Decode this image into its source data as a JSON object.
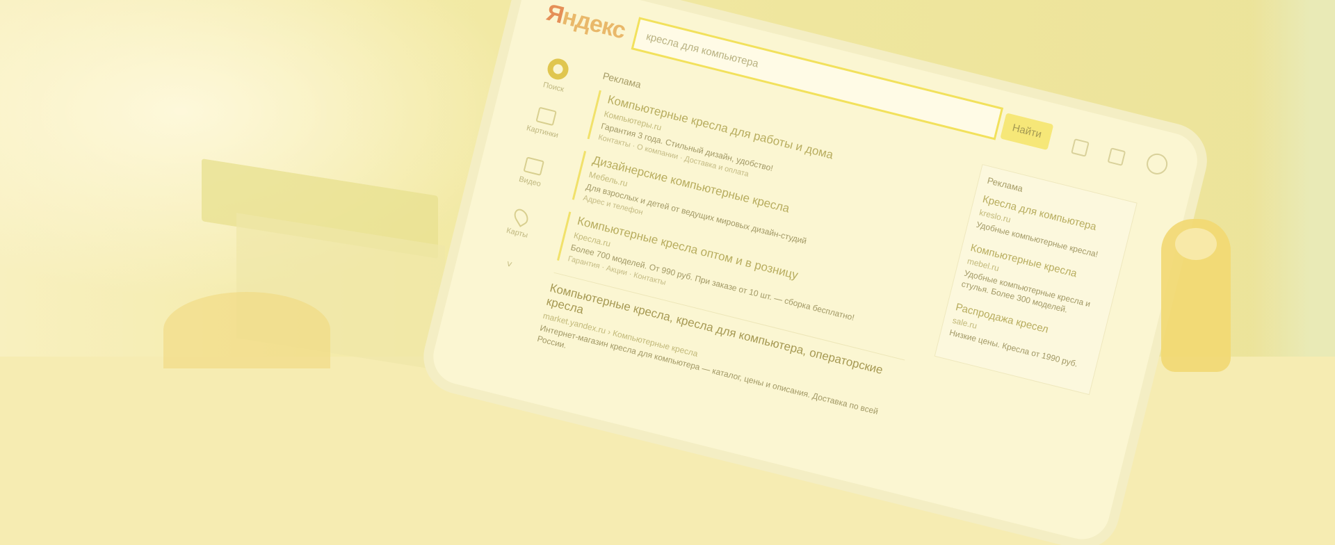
{
  "screen": {
    "logo": "Яндекс",
    "search": {
      "query": "кресла для компьютера",
      "button_label": "Найти"
    },
    "nav": [
      {
        "label": "Поиск",
        "icon": "search-icon"
      },
      {
        "label": "Картинки",
        "icon": "image-icon"
      },
      {
        "label": "Видео",
        "icon": "video-icon"
      },
      {
        "label": "Карты",
        "icon": "map-pin-icon"
      }
    ],
    "nav_more": "˅",
    "ad_label": "Реклама",
    "ads": [
      {
        "title": "Компьютерные кресла для работы и дома",
        "url": "Компьютеры.ru",
        "text": "Гарантия 3 года. Стильный дизайн, удобство!",
        "links": "Контакты · О компании · Доставка и оплата"
      },
      {
        "title": "Дизайнерские компьютерные кресла",
        "url": "Мебель.ru",
        "text": "Для взрослых и детей от ведущих мировых дизайн-студий",
        "links": "Адрес и телефон"
      },
      {
        "title": "Компьютерные кресла оптом и в розницу",
        "url": "Кресла.ru",
        "text": "Более 700 моделей. От 990 руб. При заказе от 10 шт. — сборка бесплатно!",
        "links": "Гарантия · Акции · Контакты"
      }
    ],
    "organic": {
      "title": "Компьютерные кресла, кресла для компьютера, операторские кресла",
      "url": "market.yandex.ru › Компьютерные кресла",
      "text": "Интернет-магазин кресла для компьютера — каталог, цены и описания. Доставка по всей России."
    },
    "side": {
      "label": "Реклама",
      "items": [
        {
          "title": "Кресла для компьютера",
          "url": "kreslo.ru",
          "text": "Удобные компьютерные кресла!"
        },
        {
          "title": "Компьютерные кресла",
          "url": "mebel.ru",
          "text": "Удобные компьютерные кресла и стулья. Более 300 моделей."
        },
        {
          "title": "Распродажа кресел",
          "url": "sale.ru",
          "text": "Низкие цены. Кресла от 1990 руб."
        }
      ]
    }
  }
}
